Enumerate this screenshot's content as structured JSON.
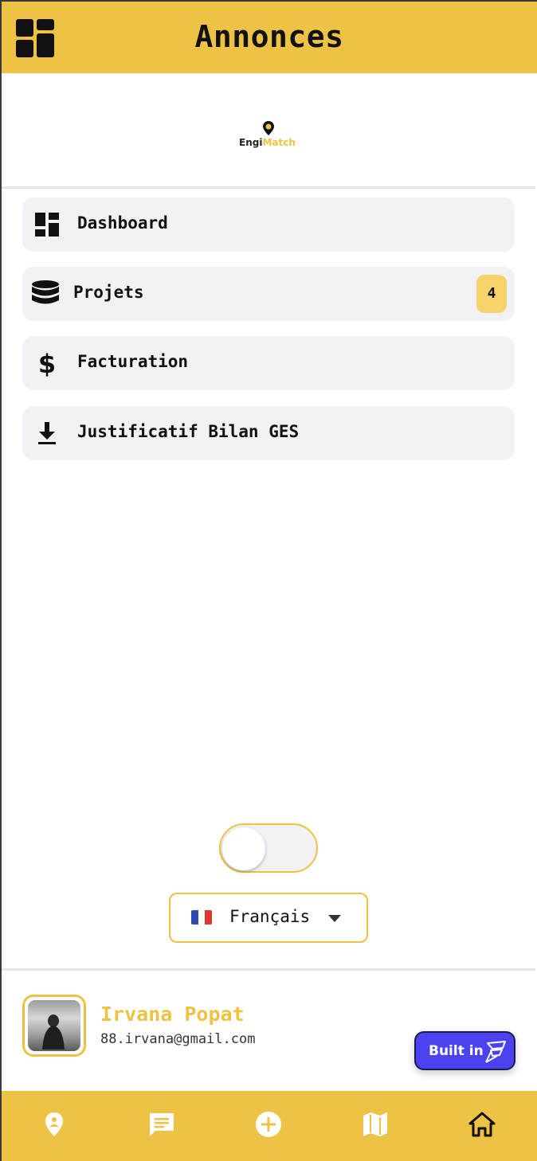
{
  "header": {
    "title": "Annonces",
    "menu_icon": "dashboard-grid-icon"
  },
  "logo": {
    "text_part1": "Engi",
    "text_part2": "Match",
    "pin_icon": "location-pin-icon"
  },
  "nav": {
    "items": [
      {
        "label": "Dashboard",
        "icon": "dashboard-icon"
      },
      {
        "label": "Projets",
        "icon": "database-icon",
        "badge": "4"
      },
      {
        "label": "Facturation",
        "icon": "dollar-icon"
      },
      {
        "label": "Justificatif Bilan GES",
        "icon": "download-icon"
      }
    ]
  },
  "theme_toggle": {
    "state": "light",
    "icon": "moon-icon"
  },
  "language": {
    "selected": "Français",
    "flag": "france-flag-icon",
    "flag_colors": [
      "#2b4bb0",
      "#ffffff",
      "#d8382e"
    ]
  },
  "profile": {
    "name": "Irvana Popat",
    "email": "88.irvana@gmail.com"
  },
  "built_in": {
    "label": "Built in",
    "icon": "flutterflow-logo-icon"
  },
  "bottom_tabs": [
    {
      "name": "location",
      "icon": "location-pin-icon",
      "active": false
    },
    {
      "name": "messages",
      "icon": "chat-icon",
      "active": false
    },
    {
      "name": "add",
      "icon": "add-circle-icon",
      "active": false
    },
    {
      "name": "map",
      "icon": "map-icon",
      "active": false
    },
    {
      "name": "home",
      "icon": "home-icon",
      "active": true
    }
  ],
  "colors": {
    "accent": "#eec345",
    "badge": "#f6d36b",
    "nav_item_bg": "#f1f1f6",
    "built_in_bg": "#4b42f1"
  }
}
